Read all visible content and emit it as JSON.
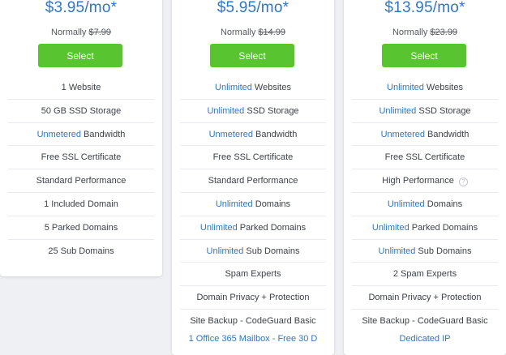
{
  "theme": {
    "accent": "#2f75c9",
    "button": "#58c42f",
    "text": "#3c4249",
    "divider": "#e7e9ed"
  },
  "plans": [
    {
      "price": "$3.95/mo*",
      "normally_label": "Normally",
      "normally_price": "$7.99",
      "select_label": "Select",
      "features": [
        {
          "hl": "",
          "text": "1 Website"
        },
        {
          "hl": "",
          "text": "50 GB SSD Storage"
        },
        {
          "hl": "Unmetered",
          "text": " Bandwidth"
        },
        {
          "hl": "",
          "text": "Free SSL Certificate"
        },
        {
          "hl": "",
          "text": "Standard Performance"
        },
        {
          "hl": "",
          "text": "1 Included Domain"
        },
        {
          "hl": "",
          "text": "5 Parked Domains"
        },
        {
          "hl": "",
          "text": "25 Sub Domains"
        }
      ]
    },
    {
      "price": "$5.95/mo*",
      "normally_label": "Normally",
      "normally_price": "$14.99",
      "select_label": "Select",
      "features": [
        {
          "hl": "Unlimited",
          "text": " Websites"
        },
        {
          "hl": "Unlimited",
          "text": " SSD Storage"
        },
        {
          "hl": "Unmetered",
          "text": " Bandwidth"
        },
        {
          "hl": "",
          "text": "Free SSL Certificate"
        },
        {
          "hl": "",
          "text": "Standard Performance"
        },
        {
          "hl": "Unlimited",
          "text": " Domains"
        },
        {
          "hl": "Unlimited",
          "text": " Parked Domains"
        },
        {
          "hl": "Unlimited",
          "text": " Sub Domains"
        },
        {
          "hl": "",
          "text": "Spam Experts"
        },
        {
          "hl": "",
          "text": "Domain Privacy + Protection"
        },
        {
          "hl": "",
          "text": "Site Backup - CodeGuard Basic"
        }
      ],
      "cutoff": "1 Office 365 Mailbox - Free 30 D"
    },
    {
      "price": "$13.95/mo*",
      "normally_label": "Normally",
      "normally_price": "$23.99",
      "select_label": "Select",
      "features": [
        {
          "hl": "Unlimited",
          "text": " Websites"
        },
        {
          "hl": "Unlimited",
          "text": " SSD Storage"
        },
        {
          "hl": "Unmetered",
          "text": " Bandwidth"
        },
        {
          "hl": "",
          "text": "Free SSL Certificate"
        },
        {
          "hl": "",
          "text": "High Performance",
          "info": "?"
        },
        {
          "hl": "Unlimited",
          "text": " Domains"
        },
        {
          "hl": "Unlimited",
          "text": " Parked Domains"
        },
        {
          "hl": "Unlimited",
          "text": " Sub Domains"
        },
        {
          "hl": "",
          "text": "2 Spam Experts"
        },
        {
          "hl": "",
          "text": "Domain Privacy + Protection"
        },
        {
          "hl": "",
          "text": "Site Backup - CodeGuard Basic"
        }
      ],
      "cutoff": "Dedicated IP"
    }
  ]
}
